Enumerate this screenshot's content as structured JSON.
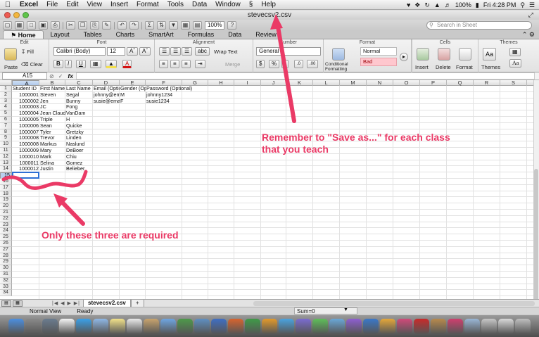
{
  "menubar": {
    "items": [
      "Excel",
      "File",
      "Edit",
      "View",
      "Insert",
      "Format",
      "Tools",
      "Data",
      "Window",
      "Help"
    ],
    "battery": "100%",
    "clock": "Fri 4:28 PM"
  },
  "window": {
    "title": "stevecsv2.csv",
    "zoom": "100%",
    "search_placeholder": "Search in Sheet"
  },
  "ribbon": {
    "tabs": [
      "Home",
      "Layout",
      "Tables",
      "Charts",
      "SmartArt",
      "Formulas",
      "Data",
      "Review"
    ],
    "active_tab": "Home",
    "groups": [
      "Edit",
      "Font",
      "Alignment",
      "Number",
      "Format",
      "Cells",
      "Themes"
    ],
    "edit": {
      "paste": "Paste",
      "fill": "Fill",
      "clear": "Clear"
    },
    "font": {
      "name": "Calibri (Body)",
      "size": "12"
    },
    "alignment": {
      "wrap": "Wrap Text",
      "merge": "Merge",
      "abc": "abc"
    },
    "number": {
      "format": "General"
    },
    "format": {
      "conditional": "Conditional Formatting",
      "style_normal": "Normal",
      "style_bad": "Bad"
    },
    "cells": {
      "insert": "Insert",
      "delete": "Delete",
      "format": "Format"
    },
    "themes": {
      "themes": "Themes",
      "aa": "Aa"
    }
  },
  "formula_bar": {
    "cell_ref": "A15",
    "fx": "fx",
    "value": ""
  },
  "grid": {
    "columns": [
      "A",
      "B",
      "C",
      "D",
      "E",
      "F",
      "G",
      "H",
      "I",
      "J",
      "K",
      "L",
      "M",
      "N",
      "O",
      "P",
      "Q",
      "R",
      "S"
    ],
    "row_count": 34,
    "header_row": [
      "Student ID",
      "First Name",
      "Last Name",
      "Email (Optio",
      "Gender (Opt",
      "Password (Optional)"
    ],
    "rows": [
      [
        "1000001",
        "Steven",
        "Segal",
        "johnny@emi",
        "M",
        "johnny1234"
      ],
      [
        "1000002",
        "Jen",
        "Bunny",
        "susie@email",
        "F",
        "susie1234"
      ],
      [
        "1000003",
        "JC",
        "Fong",
        "",
        "",
        ""
      ],
      [
        "1000004",
        "Jean Claude",
        "VanDam",
        "",
        "",
        ""
      ],
      [
        "1000005",
        "Triple",
        "H",
        "",
        "",
        ""
      ],
      [
        "1000006",
        "Sean",
        "Quicke",
        "",
        "",
        ""
      ],
      [
        "1000007",
        "Tyler",
        "Gretzky",
        "",
        "",
        ""
      ],
      [
        "1000008",
        "Trevor",
        "Linden",
        "",
        "",
        ""
      ],
      [
        "1000008",
        "Markus",
        "Naslund",
        "",
        "",
        ""
      ],
      [
        "1000009",
        "Mary",
        "DeBoer",
        "",
        "",
        ""
      ],
      [
        "1000010",
        "Mark",
        "Chiu",
        "",
        "",
        ""
      ],
      [
        "1000011",
        "Selina",
        "Gomez",
        "",
        "",
        ""
      ],
      [
        "1000012",
        "Justin",
        "Belieber",
        "",
        "",
        ""
      ]
    ]
  },
  "sheet_tabs": {
    "active": "stevecsv2.csv",
    "add": "+"
  },
  "status": {
    "view": "Normal View",
    "ready": "Ready",
    "sum": "Sum=0"
  },
  "annotations": {
    "note_save": "Remember to \"Save as...\" for each class",
    "note_save_2": "that you teach",
    "note_required": "Only these three are required",
    "color": "#ea3a66"
  },
  "colors": {
    "accent_select": "#2e6fd4",
    "bad_fill": "#ffc7ce"
  }
}
